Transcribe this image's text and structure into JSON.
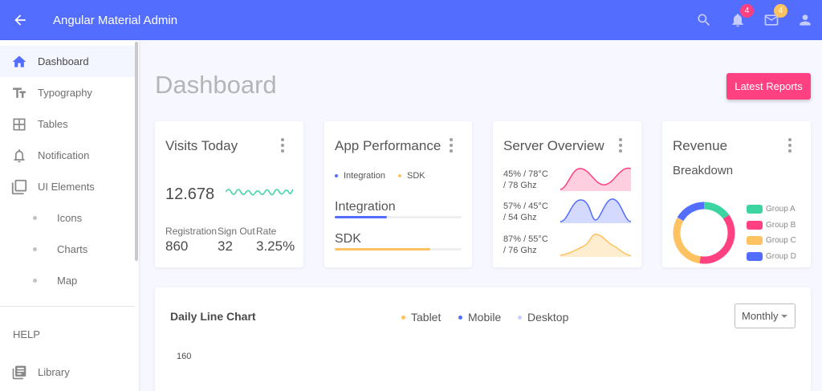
{
  "header": {
    "title": "Angular Material Admin",
    "notifications_count": "4",
    "messages_count": "4",
    "icons": [
      "arrow-back-icon",
      "search-icon",
      "bell-icon",
      "mail-icon",
      "account-icon"
    ]
  },
  "sidebar": {
    "items": [
      {
        "label": "Dashboard",
        "icon": "home-icon"
      },
      {
        "label": "Typography",
        "icon": "text-fields-icon"
      },
      {
        "label": "Tables",
        "icon": "table-icon"
      },
      {
        "label": "Notification",
        "icon": "bell-outline-icon"
      },
      {
        "label": "UI Elements",
        "icon": "library-icon"
      },
      {
        "label": "Icons"
      },
      {
        "label": "Charts"
      },
      {
        "label": "Map"
      }
    ],
    "help_title": "HELP",
    "help_items": [
      {
        "label": "Library",
        "icon": "library-books-icon"
      }
    ]
  },
  "page": {
    "title": "Dashboard",
    "reports_button": "Latest Reports"
  },
  "visits": {
    "title": "Visits Today",
    "total": "12.678",
    "stats": [
      {
        "label": "Registration",
        "value": "860"
      },
      {
        "label": "Sign Out",
        "value": "32"
      },
      {
        "label": "Rate",
        "value": "3.25%"
      }
    ]
  },
  "performance": {
    "title": "App Performance",
    "legend": [
      "Integration",
      "SDK"
    ],
    "bars": [
      {
        "label": "Integration",
        "level": 0.41,
        "color": "#536dfe"
      },
      {
        "label": "SDK",
        "level": 0.75,
        "color": "#ffc260"
      }
    ]
  },
  "server": {
    "title": "Server Overview",
    "rows": [
      {
        "line1": "45% / 78°C",
        "line2": "/ 78 Ghz",
        "color": "#ff4081"
      },
      {
        "line1": "57% / 45°C",
        "line2": "/ 54 Ghz",
        "color": "#536dfe"
      },
      {
        "line1": "87% / 55°C",
        "line2": "/ 76 Ghz",
        "color": "#ffc260"
      }
    ]
  },
  "revenue": {
    "title": "Revenue",
    "subtitle": "Breakdown",
    "groups": [
      {
        "label": "Group A",
        "color": "#3cd4a0"
      },
      {
        "label": "Group B",
        "color": "#ff4081"
      },
      {
        "label": "Group C",
        "color": "#ffc260"
      },
      {
        "label": "Group D",
        "color": "#536dfe"
      }
    ]
  },
  "daily_chart": {
    "title": "Daily Line Chart",
    "legend": [
      {
        "label": "Tablet",
        "color": "#ffc260"
      },
      {
        "label": "Mobile",
        "color": "#536dfe"
      },
      {
        "label": "Desktop",
        "color": "#c9cfff"
      }
    ],
    "period_select": "Monthly",
    "y_tick_top": "160"
  },
  "colors": {
    "primary": "#536dfe",
    "secondary": "#ff4081",
    "warning": "#ffc260",
    "success": "#3cd4a0"
  }
}
